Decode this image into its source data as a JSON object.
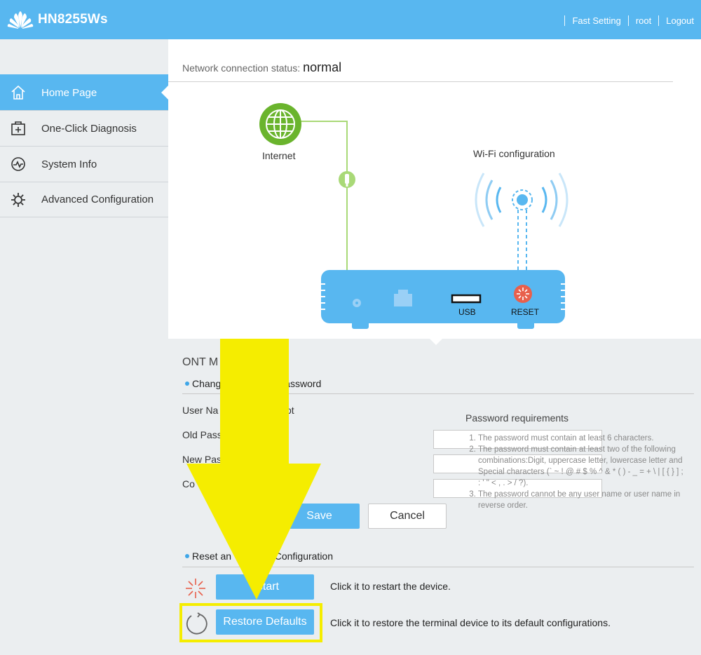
{
  "header": {
    "title": "HN8255Ws",
    "links": [
      "Fast Setting",
      "root",
      "Logout"
    ]
  },
  "sidebar": {
    "items": [
      {
        "label": "Home Page",
        "icon": "home-icon",
        "active": true
      },
      {
        "label": "One-Click Diagnosis",
        "icon": "diagnosis-icon",
        "active": false
      },
      {
        "label": "System Info",
        "icon": "pulse-icon",
        "active": false
      },
      {
        "label": "Advanced Configuration",
        "icon": "gear-icon",
        "active": false
      }
    ]
  },
  "status": {
    "label": "Network connection status:",
    "value": "normal"
  },
  "diagram": {
    "internet_label": "Internet",
    "wifi_label": "Wi-Fi configuration",
    "usb_label": "USB",
    "reset_label": "RESET"
  },
  "ont": {
    "title_visible": "ONT M",
    "password_section_visible_start": "Chang",
    "password_section_visible_end": "nt Password",
    "username_label_visible": "User Na",
    "username_value_visible": "ot",
    "old_password_label_visible": "Old Pass",
    "new_password_label_visible": "New Pas",
    "confirm_password_label_visible": "Co",
    "save_label": "Save",
    "cancel_label": "Cancel",
    "requirements": {
      "title": "Password requirements",
      "items": [
        "The password must contain at least 6 characters.",
        "The password must contain at least two of the following combinations:Digit, uppercase letter, lowercase letter and Special characters (` ~ ! @ # $ % ^ & * ( ) - _ = + \\ | [ { } ] ; : ' \" < , . > / ?).",
        "The password cannot be any user name or user name in reverse order."
      ]
    },
    "reset_section_visible_start": "Reset an",
    "reset_section_visible_end": "e Configuration",
    "restart_label_visible": "estart",
    "restart_desc": "Click it to restart the device.",
    "restore_label": "Restore Defaults",
    "restore_desc": "Click it to restore the terminal device to its default configurations."
  },
  "colors": {
    "accent": "#58b7f0",
    "internet_green": "#6ab42d",
    "reset_red": "#e8604c",
    "annotation_yellow": "#f5ed00"
  }
}
